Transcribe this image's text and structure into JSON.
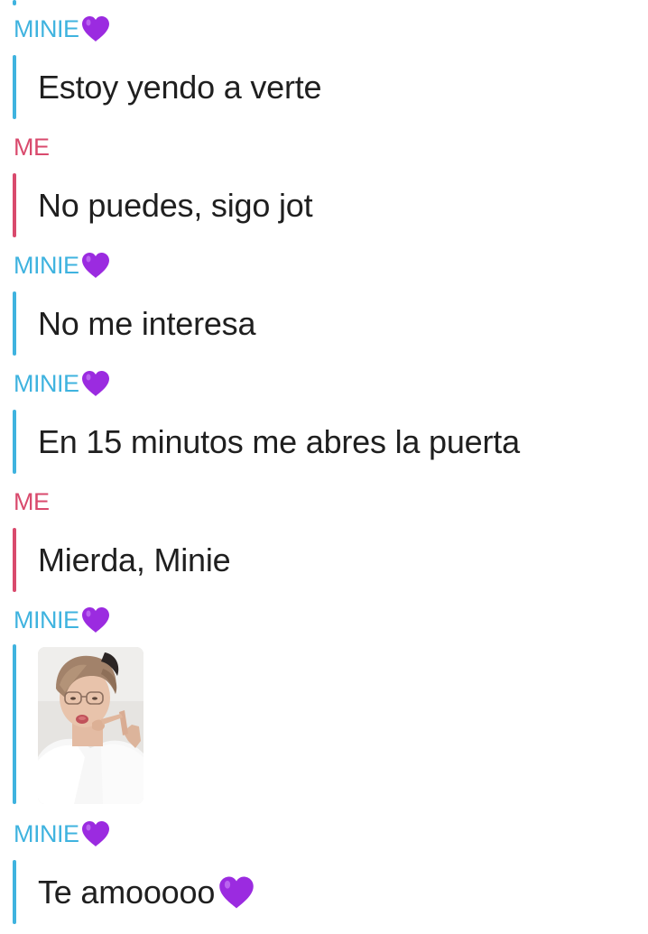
{
  "colors": {
    "minie": "#3fb3df",
    "me": "#d94a6d",
    "heart": "#9b2be0",
    "text": "#1f1f1f"
  },
  "messages": [
    {
      "sender": "MINIE",
      "heart": "purple-heart-icon",
      "text": "Estoy yendo a verte"
    },
    {
      "sender": "ME",
      "text": "No puedes, sigo jot"
    },
    {
      "sender": "MINIE",
      "heart": "purple-heart-icon",
      "text": "No me interesa"
    },
    {
      "sender": "MINIE",
      "heart": "purple-heart-icon",
      "text": "En 15 minutos me abres la puerta"
    },
    {
      "sender": "ME",
      "text": "Mierda, Minie"
    },
    {
      "sender": "MINIE",
      "heart": "purple-heart-icon",
      "image": "photo-of-person-with-glasses"
    },
    {
      "sender": "MINIE",
      "heart": "purple-heart-icon",
      "text": "Te amooooo",
      "text_heart": "purple-heart-icon"
    }
  ]
}
